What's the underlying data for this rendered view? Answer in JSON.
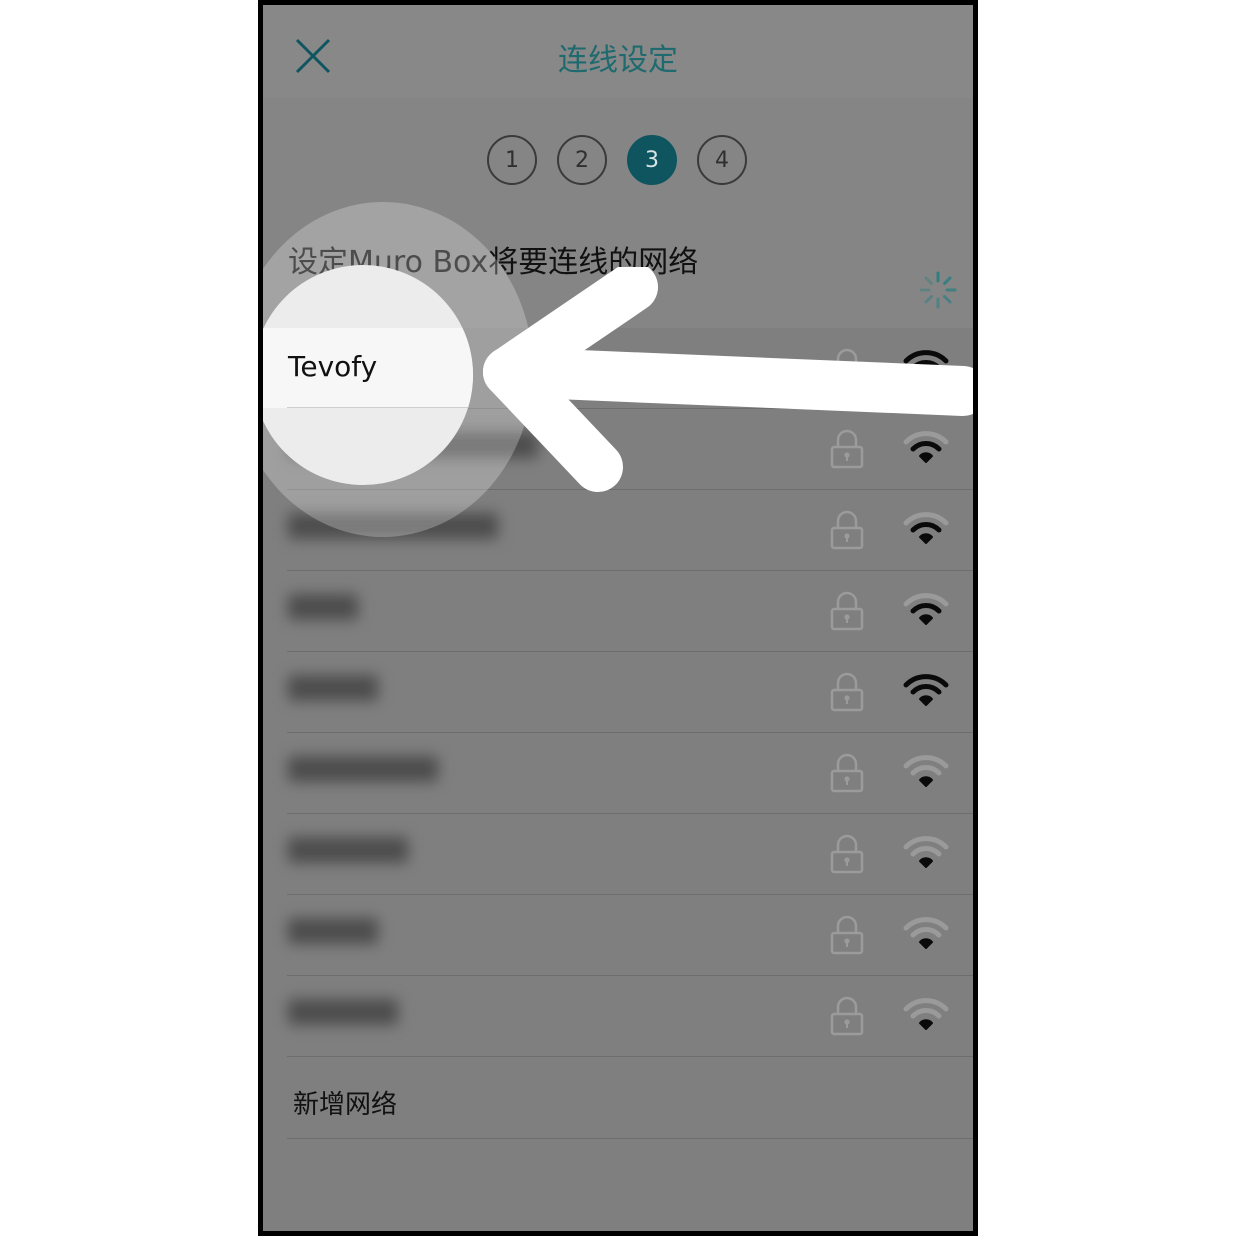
{
  "header": {
    "title": "连线设定",
    "close_icon": "close-icon"
  },
  "steps": [
    {
      "label": "1",
      "active": false
    },
    {
      "label": "2",
      "active": false
    },
    {
      "label": "3",
      "active": true
    },
    {
      "label": "4",
      "active": false
    }
  ],
  "prompt": "设定Muro Box将要连线的网络",
  "colors": {
    "accent": "#0e5560",
    "title": "#1f6a6e",
    "overlay": "#7f7f7f"
  },
  "networks": [
    {
      "ssid": "Tevofy",
      "visible": true,
      "locked": true,
      "signal": "strong"
    },
    {
      "ssid": "",
      "visible": false,
      "locked": true,
      "signal": "medium"
    },
    {
      "ssid": "",
      "visible": false,
      "locked": true,
      "signal": "medium"
    },
    {
      "ssid": "",
      "visible": false,
      "locked": true,
      "signal": "medium"
    },
    {
      "ssid": "",
      "visible": false,
      "locked": true,
      "signal": "strong"
    },
    {
      "ssid": "",
      "visible": false,
      "locked": true,
      "signal": "weak"
    },
    {
      "ssid": "",
      "visible": false,
      "locked": true,
      "signal": "weak"
    },
    {
      "ssid": "",
      "visible": false,
      "locked": true,
      "signal": "weak"
    },
    {
      "ssid": "",
      "visible": false,
      "locked": true,
      "signal": "weak"
    }
  ],
  "add_network_label": "新增网络",
  "annotation": {
    "highlighted_network": "Tevofy",
    "pointer": "arrow-icon"
  }
}
